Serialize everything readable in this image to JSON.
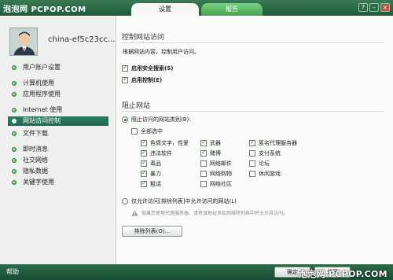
{
  "watermark_top": "泡泡网 PCPOP.COM",
  "watermark_bottom": "泡泡网 PCPOP.COM",
  "tabs": [
    {
      "label": "设置"
    },
    {
      "label": "报告"
    }
  ],
  "window_buttons": {
    "help": "?",
    "minimize": "–",
    "close": "×"
  },
  "user": {
    "name": "china-ef5c23cc..."
  },
  "nav": [
    {
      "label": "用户账户设置"
    },
    {
      "label": "计算机使用"
    },
    {
      "label": "应用程序使用"
    },
    {
      "label": "Internet 使用"
    },
    {
      "label": "网站访问控制"
    },
    {
      "label": "文件下载"
    },
    {
      "label": "即时消息"
    },
    {
      "label": "社交网络"
    },
    {
      "label": "隐私数据"
    },
    {
      "label": "关键字使用"
    }
  ],
  "section1": {
    "title": "控制网站访问",
    "description": "根据网站内容，控制用户访问。",
    "safe_search": "启用安全搜索(S)",
    "enable_control": "启用控制(E)"
  },
  "section2": {
    "title": "阻止网站",
    "radio_block_categories": "阻止访问的网站类别(B):",
    "select_all": "全部选中",
    "categories": [
      {
        "label": "色情文字，性爱",
        "checked": true
      },
      {
        "label": "武器",
        "checked": true
      },
      {
        "label": "匿名代理服务器",
        "checked": true
      },
      {
        "label": "违法软件",
        "checked": true
      },
      {
        "label": "赌博",
        "checked": true
      },
      {
        "label": "支付系统",
        "checked": false
      },
      {
        "label": "毒品",
        "checked": true
      },
      {
        "label": "网络邮件",
        "checked": false
      },
      {
        "label": "论坛",
        "checked": false
      },
      {
        "label": "暴力",
        "checked": true
      },
      {
        "label": "网络购物",
        "checked": false
      },
      {
        "label": "休闲游戏",
        "checked": false
      },
      {
        "label": "粗话",
        "checked": true
      },
      {
        "label": "网络社区",
        "checked": false
      }
    ],
    "radio_allow_only": "仅允许访问[排除列表]中允许访问的网站(L)",
    "warning": "如果您使用代理服务器，请将该地址添加到排除列表中并允许其访问。",
    "exclude_button": "排除列表(O)..."
  },
  "footer": {
    "help": "帮助",
    "ok": "确定",
    "close": "关闭"
  }
}
